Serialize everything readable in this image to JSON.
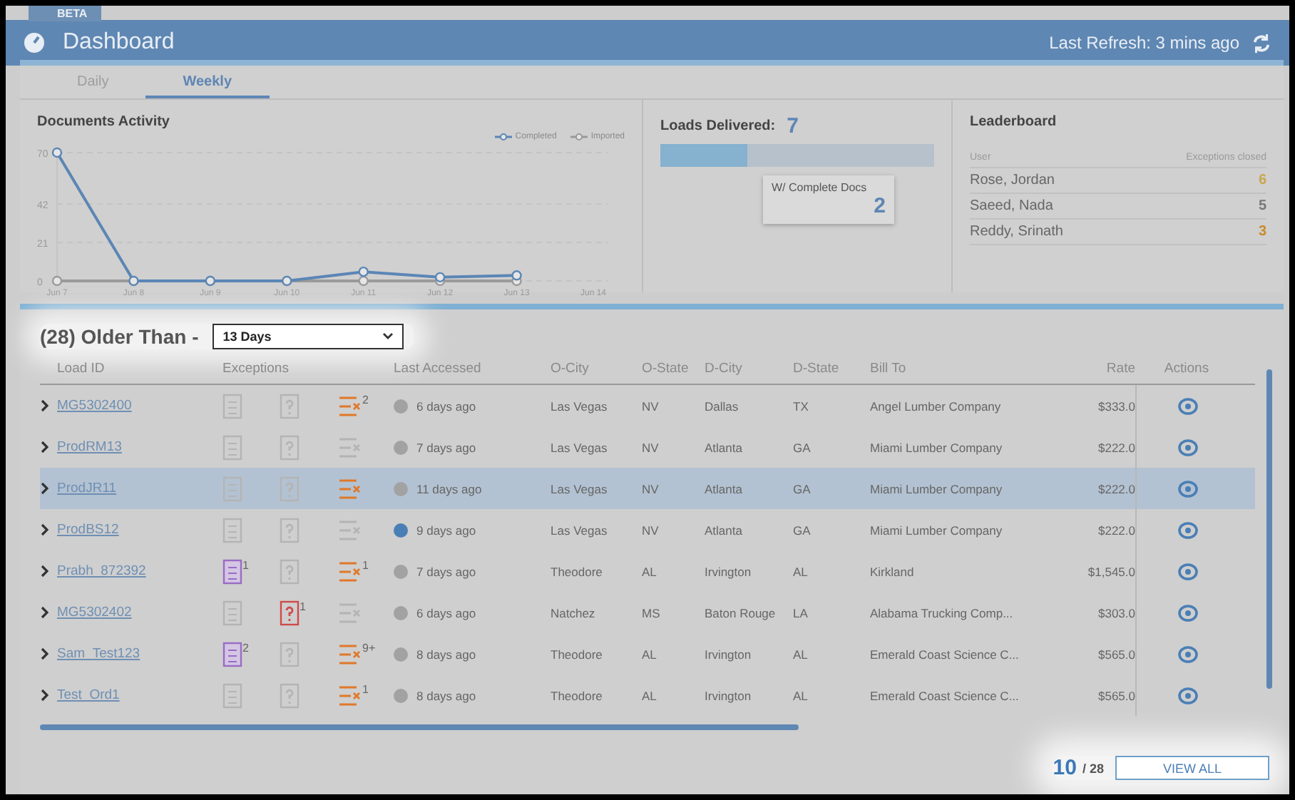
{
  "badge": "BETA",
  "header": {
    "title": "Dashboard",
    "refresh": "Last Refresh: 3 mins ago"
  },
  "tabs": [
    {
      "label": "Daily",
      "selected": false
    },
    {
      "label": "Weekly",
      "selected": true
    }
  ],
  "activity": {
    "title": "Documents Activity",
    "chart_data": {
      "type": "line",
      "x": [
        "Jun 7",
        "Jun 8",
        "Jun 9",
        "Jun 10",
        "Jun 11",
        "Jun 12",
        "Jun 13",
        "Jun 14"
      ],
      "ylim": [
        0,
        70
      ],
      "yticks": [
        0,
        21,
        42,
        70
      ],
      "grid": true,
      "legend": "top-right",
      "series": [
        {
          "name": "Completed",
          "color": "#5b86b5",
          "marker": "circle",
          "values": [
            70,
            0,
            0,
            0,
            5,
            2,
            3,
            null
          ]
        },
        {
          "name": "Imported",
          "color": "#9a9a9a",
          "marker": "circle",
          "values": [
            0,
            0,
            0,
            0,
            0,
            0,
            0,
            null
          ]
        }
      ]
    }
  },
  "loads": {
    "label": "Loads Delivered:",
    "value": "7",
    "level": 0.32,
    "sub_label": "W/ Complete Docs",
    "sub_value": "2"
  },
  "leaderboard": {
    "title": "Leaderboard",
    "columns": [
      "User",
      "Exceptions closed"
    ],
    "rows": [
      {
        "user": "Rose, Jordan",
        "count": "6",
        "color": "#c9a64a"
      },
      {
        "user": "Saeed, Nada",
        "count": "5",
        "color": "#777777"
      },
      {
        "user": "Reddy, Srinath",
        "count": "3",
        "color": "#c98a2a"
      }
    ]
  },
  "older": {
    "title": "(28) Older Than -",
    "select": "13 Days"
  },
  "table": {
    "columns": [
      "Load ID",
      "Exceptions",
      "Last Accessed",
      "O-City",
      "O-State",
      "D-City",
      "D-State",
      "Bill To",
      "Rate",
      "Actions"
    ],
    "rows": [
      {
        "id": "MG5302400",
        "selected": false,
        "exceptions": [
          {
            "kind": "doc",
            "active": false
          },
          {
            "kind": "question",
            "active": false
          },
          {
            "kind": "list",
            "active": true,
            "count": "2"
          }
        ],
        "avatar_active": false,
        "accessed": "6 days ago",
        "o_city": "Las Vegas",
        "o_state": "NV",
        "d_city": "Dallas",
        "d_state": "TX",
        "bill_to": "Angel Lumber Company",
        "rate": "$333.0"
      },
      {
        "id": "ProdRM13",
        "selected": false,
        "exceptions": [
          {
            "kind": "doc",
            "active": false
          },
          {
            "kind": "question",
            "active": false
          },
          {
            "kind": "list",
            "active": false
          }
        ],
        "avatar_active": false,
        "accessed": "7 days ago",
        "o_city": "Las Vegas",
        "o_state": "NV",
        "d_city": "Atlanta",
        "d_state": "GA",
        "bill_to": "Miami Lumber Company",
        "rate": "$222.0"
      },
      {
        "id": "ProdJR11",
        "selected": true,
        "exceptions": [
          {
            "kind": "doc",
            "active": false
          },
          {
            "kind": "question",
            "active": false
          },
          {
            "kind": "list",
            "active": true
          }
        ],
        "avatar_active": false,
        "accessed": "11 days ago",
        "o_city": "Las Vegas",
        "o_state": "NV",
        "d_city": "Atlanta",
        "d_state": "GA",
        "bill_to": "Miami Lumber Company",
        "rate": "$222.0"
      },
      {
        "id": "ProdBS12",
        "selected": false,
        "exceptions": [
          {
            "kind": "doc",
            "active": false
          },
          {
            "kind": "question",
            "active": false
          },
          {
            "kind": "list",
            "active": false
          }
        ],
        "avatar_active": true,
        "accessed": "9 days ago",
        "o_city": "Las Vegas",
        "o_state": "NV",
        "d_city": "Atlanta",
        "d_state": "GA",
        "bill_to": "Miami Lumber Company",
        "rate": "$222.0"
      },
      {
        "id": "Prabh_872392",
        "selected": false,
        "exceptions": [
          {
            "kind": "doc",
            "active": true,
            "count": "1"
          },
          {
            "kind": "question",
            "active": false
          },
          {
            "kind": "list",
            "active": true,
            "count": "1"
          }
        ],
        "avatar_active": false,
        "accessed": "7 days ago",
        "o_city": "Theodore",
        "o_state": "AL",
        "d_city": "Irvington",
        "d_state": "AL",
        "bill_to": "Kirkland",
        "rate": "$1,545.0"
      },
      {
        "id": "MG5302402",
        "selected": false,
        "exceptions": [
          {
            "kind": "doc",
            "active": false
          },
          {
            "kind": "question",
            "active": true,
            "count": "1"
          },
          {
            "kind": "list",
            "active": false
          }
        ],
        "avatar_active": false,
        "accessed": "6 days ago",
        "o_city": "Natchez",
        "o_state": "MS",
        "d_city": "Baton Rouge",
        "d_state": "LA",
        "bill_to": "Alabama Trucking Comp...",
        "rate": "$303.0"
      },
      {
        "id": "Sam_Test123",
        "selected": false,
        "exceptions": [
          {
            "kind": "doc",
            "active": true,
            "count": "2"
          },
          {
            "kind": "question",
            "active": false
          },
          {
            "kind": "list",
            "active": true,
            "count": "9+"
          }
        ],
        "avatar_active": false,
        "accessed": "8 days ago",
        "o_city": "Theodore",
        "o_state": "AL",
        "d_city": "Irvington",
        "d_state": "AL",
        "bill_to": "Emerald Coast Science C...",
        "rate": "$565.0"
      },
      {
        "id": "Test_Ord1",
        "selected": false,
        "exceptions": [
          {
            "kind": "doc",
            "active": false
          },
          {
            "kind": "question",
            "active": false
          },
          {
            "kind": "list",
            "active": true,
            "count": "1"
          }
        ],
        "avatar_active": false,
        "accessed": "8 days ago",
        "o_city": "Theodore",
        "o_state": "AL",
        "d_city": "Irvington",
        "d_state": "AL",
        "bill_to": "Emerald Coast Science C...",
        "rate": "$565.0"
      }
    ]
  },
  "pager": {
    "shown": "10",
    "total": "/ 28",
    "button": "VIEW ALL"
  }
}
